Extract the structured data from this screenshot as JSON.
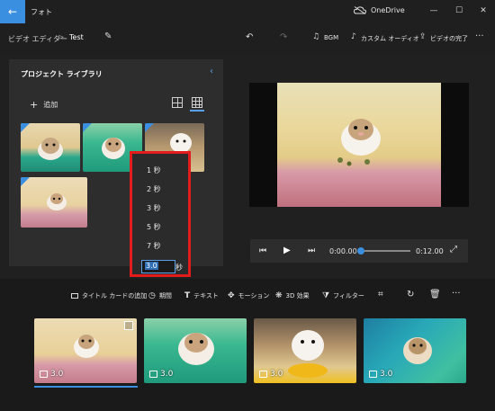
{
  "titlebar": {
    "back_icon": "←",
    "app_title": "フォト",
    "onedrive_label": "OneDrive",
    "minimize": "—",
    "maximize": "☐",
    "close": "✕"
  },
  "commandbar": {
    "breadcrumb_parent": "ビデオ エディター",
    "breadcrumb_separator": ">",
    "project_name": "Test",
    "undo_icon": "↶",
    "redo_icon": "↷",
    "bgm_label": "BGM",
    "custom_audio_label": "カスタム オーディオ",
    "finish_video_label": "ビデオの完了",
    "more_icon": "···"
  },
  "library": {
    "title": "プロジェクト ライブラリ",
    "add_label": "追加",
    "add_icon": "+",
    "collapse_icon": "‹"
  },
  "duration_popup": {
    "options": [
      "1 秒",
      "2 秒",
      "3 秒",
      "5 秒",
      "7 秒"
    ],
    "custom_value": "3.0",
    "unit": "秒"
  },
  "player": {
    "current_time": "0:00.00",
    "total_time": "0:12.00",
    "progress": 0.0
  },
  "storyboard": {
    "tools": [
      {
        "icon": "title-card-icon",
        "label": "タイトル カードの追加"
      },
      {
        "icon": "duration-icon",
        "label": "期間"
      },
      {
        "icon": "text-icon",
        "label": "テキスト"
      },
      {
        "icon": "motion-icon",
        "label": "モーション"
      },
      {
        "icon": "3d-effects-icon",
        "label": "3D 効果"
      },
      {
        "icon": "filter-icon",
        "label": "フィルター"
      }
    ],
    "clips": [
      {
        "duration": "3.0"
      },
      {
        "duration": "3.0"
      },
      {
        "duration": "3.0"
      },
      {
        "duration": "3.0"
      }
    ],
    "more_icon": "···"
  },
  "colors": {
    "accent": "#3a8fe0",
    "highlight_box": "#e21c1c",
    "background": "#202020"
  }
}
